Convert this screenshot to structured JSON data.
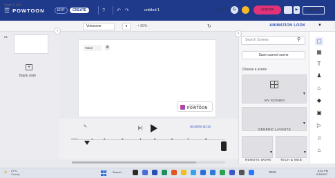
{
  "topbar": {
    "brand": "POWTOON",
    "edit_label": "EDIT",
    "create_label": "CREATE",
    "doc_title": "untitled 1",
    "saved_label": "SAVED",
    "avatar_initial": "G",
    "upgrade_label": "Upgrade",
    "export_label": "EXPORT",
    "brand_color": "#1f3a8a",
    "upgrade_color": "#e3317a"
  },
  "subbar": {
    "slide_label": "Slide 1 of 1",
    "voice_label": "Voiceover",
    "zoom_label": "+ 85% -",
    "animation_look": "ANIMATION LOOK"
  },
  "left_panel": {
    "slide_number": "01",
    "blank_slide_label": "Blank slide"
  },
  "canvas": {
    "chip_label": "Voice",
    "logo_small": "created using",
    "logo_big": "POWTOON"
  },
  "timeline": {
    "time_readout": "00:00/00 00:10",
    "sec_label": "0SEC",
    "ticks": [
      "1",
      "2",
      "3",
      "4",
      "5",
      "6",
      "7",
      "8"
    ]
  },
  "right_panel": {
    "search_placeholder": "Search Scenes",
    "save_scene_label": "Save current scene",
    "choose_label": "Choose a scene",
    "cards": {
      "my_scenes": "MY SCENES",
      "generic_layouts": "GENERIC LAYOUTS",
      "remote_work": "REMOTE WORK",
      "tech_web": "TECH & WEB"
    }
  },
  "side_rail": {
    "icons": [
      "layout-icon",
      "pattern-icon",
      "text-icon",
      "characters-icon",
      "props-icon",
      "shapes-icon",
      "media-icon",
      "video-icon",
      "music-icon",
      "templates-icon"
    ]
  },
  "taskbar": {
    "weather_temp": "27°C",
    "weather_cond": "Cloudy",
    "search_label": "Search",
    "tray_label": "ENG",
    "clock_time": "3:51 PM",
    "clock_date": "2/3/2022"
  }
}
